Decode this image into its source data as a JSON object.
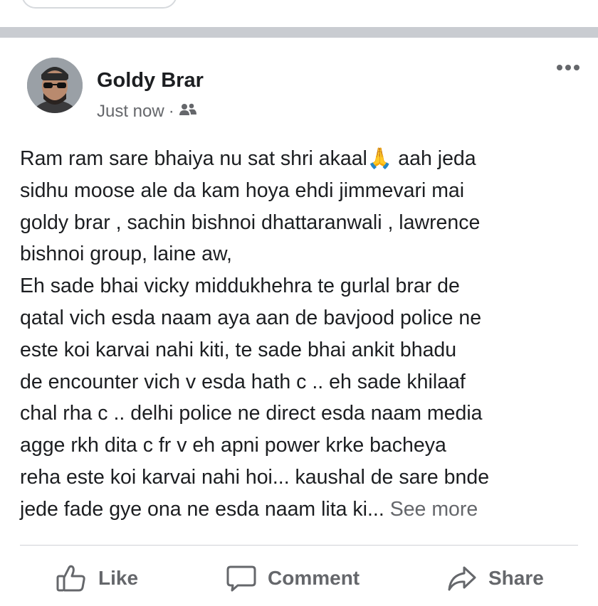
{
  "post": {
    "author": "Goldy Brar",
    "timestamp": "Just now",
    "separator_dot": "·",
    "audience_icon": "friends-icon",
    "body_lines": [
      "Ram ram sare bhaiya nu sat shri akaal🙏 aah jeda",
      "sidhu moose ale da kam hoya ehdi jimmevari mai",
      "goldy brar , sachin bishnoi dhattaranwali , lawrence",
      "bishnoi group,  laine aw,",
      "Eh sade bhai vicky middukhehra te gurlal brar de",
      "qatal vich esda naam aya aan de bavjood police ne",
      "este koi karvai nahi kiti, te sade bhai ankit bhadu",
      "de encounter vich v esda hath c .. eh sade khilaaf",
      "chal rha c .. delhi police ne direct esda naam media",
      "agge rkh dita c fr v eh apni power krke bacheya",
      "reha este koi karvai nahi hoi... kaushal de sare bnde",
      "jede fade gye ona ne esda naam lita ki..."
    ],
    "see_more": "See more"
  },
  "actions": {
    "like": "Like",
    "comment": "Comment",
    "share": "Share"
  },
  "colors": {
    "separator": "#c9ccd1",
    "secondary_text": "#65676b",
    "primary_text": "#1c1e21"
  }
}
